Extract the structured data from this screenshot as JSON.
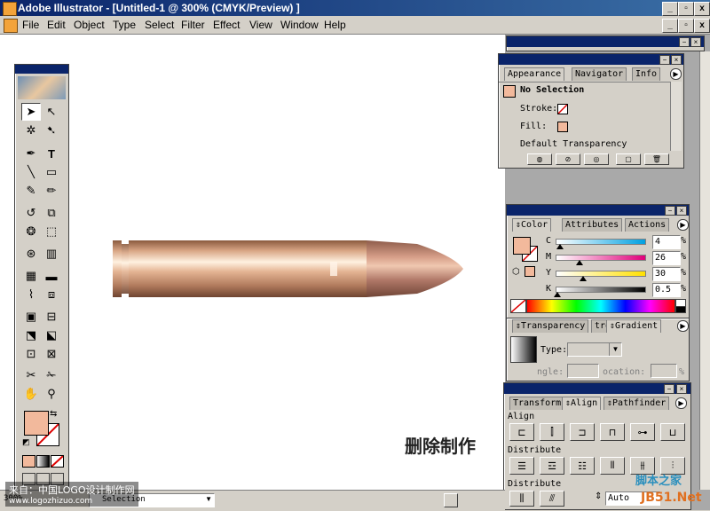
{
  "window": {
    "title": "Adobe Illustrator - [Untitled-1 @ 300% (CMYK/Preview) ]",
    "controls": [
      "_",
      "▫",
      "x"
    ]
  },
  "menu": [
    "File",
    "Edit",
    "Object",
    "Type",
    "Select",
    "Filter",
    "Effect",
    "View",
    "Window",
    "Help"
  ],
  "appearance_panel": {
    "tabs": [
      "Appearance",
      "Navigator",
      "Info"
    ],
    "selection": "No Selection",
    "stroke_label": "Stroke:",
    "fill_label": "Fill:",
    "transparency": "Default Transparency"
  },
  "color_panel": {
    "tabs": [
      "Color",
      "Attributes",
      "Actions"
    ],
    "channels": [
      {
        "label": "C",
        "value": "4",
        "level": 4
      },
      {
        "label": "M",
        "value": "26",
        "level": 26
      },
      {
        "label": "Y",
        "value": "30",
        "level": 30
      },
      {
        "label": "K",
        "value": "0.5",
        "level": 0.5
      }
    ],
    "unit": "%",
    "fill_color": "#f2b99c"
  },
  "transparency_panel": {
    "tabs": [
      "Transparency",
      "tro",
      "Gradient"
    ],
    "type_label": "Type:",
    "angle_label": "ngle:",
    "location_label": "ocation:",
    "unit": "%"
  },
  "align_panel": {
    "tabs": [
      "Transform",
      "Align",
      "Pathfinder"
    ],
    "align_label": "Align",
    "distribute_label": "Distribute",
    "distribute_spacing_label": "Distribute",
    "spacing_value": "Auto"
  },
  "canvas": {
    "annotation": "删除制作"
  },
  "statusbar": {
    "zoom": "300%",
    "info": "Selection"
  },
  "watermarks": {
    "left_line1": "来自：中国LOGO设计制作网",
    "left_line2": "www.logozhizuo.com",
    "right_line1": "脚本之家",
    "right_line2": "JB51.Net"
  },
  "colors": {
    "title_blue": "#0a246a",
    "panel_gray": "#d4d0c8",
    "fill_swatch": "#f2b99c",
    "stroke_swatch": "#ffffff"
  }
}
